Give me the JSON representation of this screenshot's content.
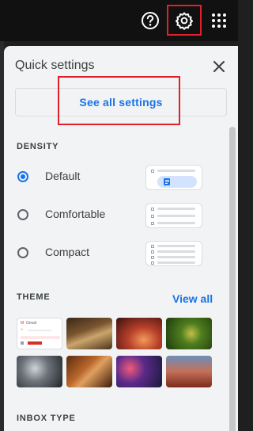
{
  "toolbar": {
    "icons": [
      "help-icon",
      "gear-icon",
      "apps-grid-icon"
    ]
  },
  "quick_settings": {
    "title": "Quick settings",
    "see_all_label": "See all settings"
  },
  "density": {
    "heading": "DENSITY",
    "options": [
      {
        "label": "Default",
        "selected": true
      },
      {
        "label": "Comfortable",
        "selected": false
      },
      {
        "label": "Compact",
        "selected": false
      }
    ]
  },
  "theme": {
    "heading": "THEME",
    "view_all_label": "View all",
    "preview_brand": "Gmail"
  },
  "inbox_type": {
    "heading": "INBOX TYPE"
  },
  "colors": {
    "accent": "#1a73e8",
    "highlight": "#e0202a"
  }
}
